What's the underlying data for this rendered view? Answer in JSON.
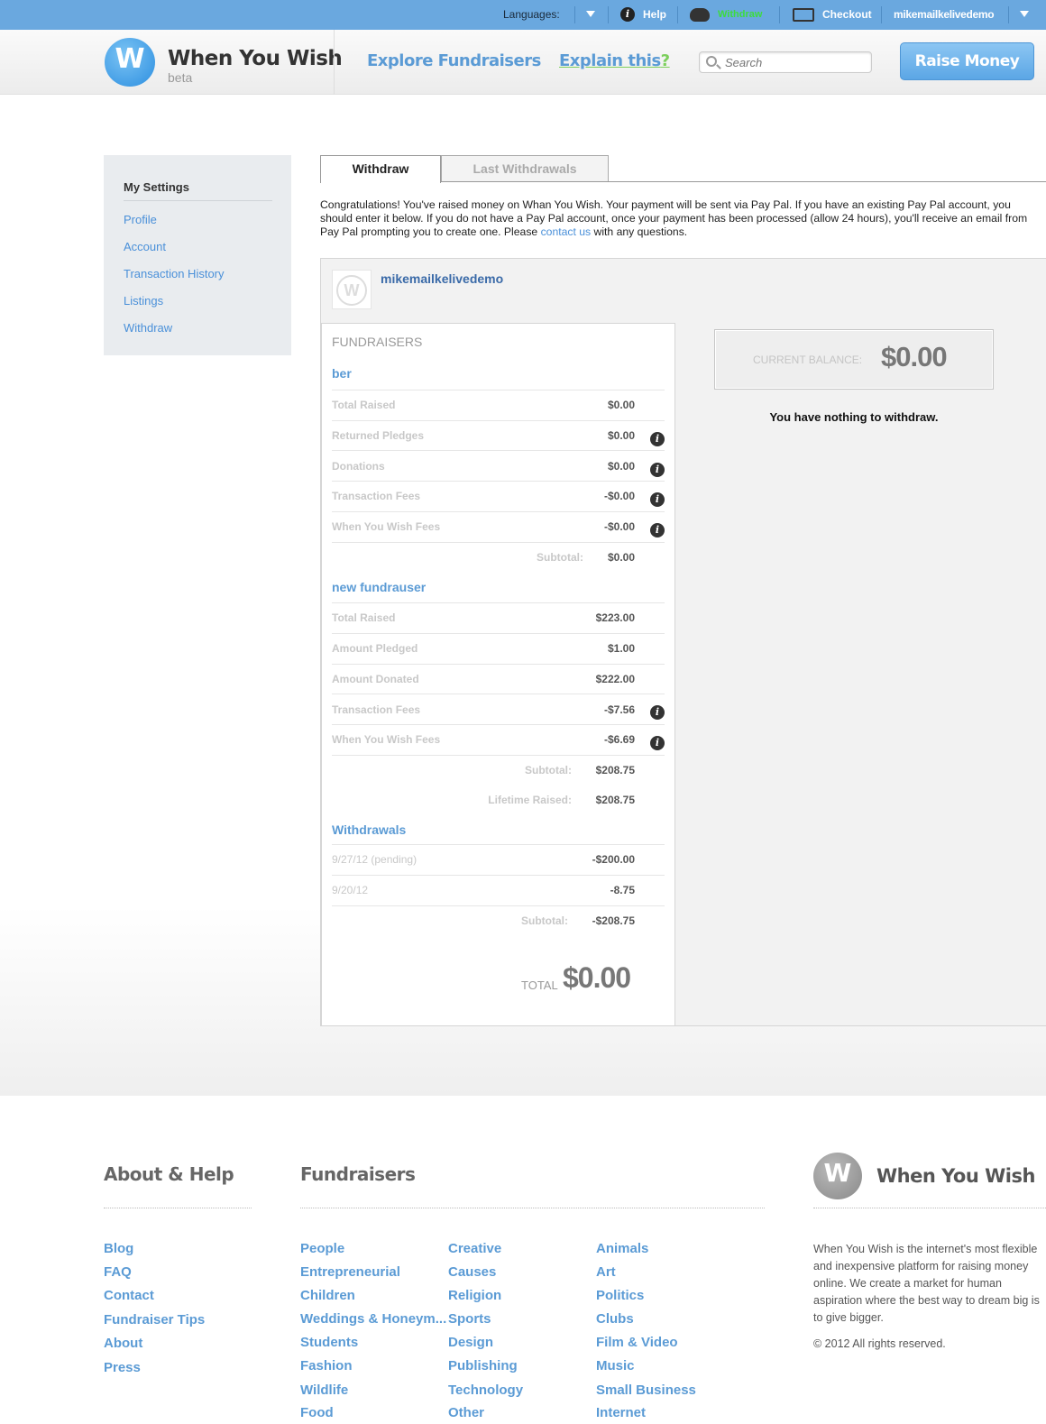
{
  "topbar": {
    "languages_label": "Languages:",
    "help_label": "Help",
    "wishes_label": "Withdraw",
    "checkout_label": "Checkout",
    "username": "mikemailkelivedemo"
  },
  "header": {
    "logo_text": "When You Wish",
    "logo_letter": "W",
    "beta": "beta",
    "explore": "Explore Fundraisers",
    "explain": "Explain this",
    "explain_mark": "?",
    "search_placeholder": "Search",
    "raise_button": "Raise Money"
  },
  "sidebar": {
    "title": "My Settings",
    "items": [
      "Profile",
      "Account",
      "Transaction History",
      "Listings",
      "Withdraw"
    ]
  },
  "tabs": {
    "withdraw": "Withdraw",
    "last_withdrawals": "Last Withdrawals"
  },
  "intro": {
    "text_before": "Congratulations! You've raised money on Whan You Wish. Your payment will be sent via Pay Pal. If you have an existing Pay Pal account, you should enter it below. If you do not have a Pay Pal account, once your payment has been processed (allow 24 hours), you'll receive an email from Pay Pal prompting you to create one. Please ",
    "link": "contact us",
    "text_after": " with any questions."
  },
  "account": {
    "username": "mikemailkelivedemo",
    "avatar_letter": "W"
  },
  "fundraisers": {
    "title": "FUNDRAISERS",
    "f1": {
      "name": "ber",
      "rows": [
        {
          "label": "Total Raised",
          "value": "$0.00"
        },
        {
          "label": "Returned Pledges",
          "value": "$0.00"
        },
        {
          "label": "Donations",
          "value": "$0.00"
        },
        {
          "label": "Transaction Fees",
          "value": "-$0.00"
        },
        {
          "label": "When You Wish Fees",
          "value": "-$0.00"
        }
      ],
      "subtotal_label": "Subtotal:",
      "subtotal": "$0.00"
    },
    "f2": {
      "name": "new fundrauser",
      "rows": [
        {
          "label": "Total Raised",
          "value": "$223.00"
        },
        {
          "label": "Amount Pledged",
          "value": "$1.00"
        },
        {
          "label": "Amount Donated",
          "value": "$222.00"
        },
        {
          "label": "Transaction Fees",
          "value": "-$7.56"
        },
        {
          "label": "When You Wish Fees",
          "value": "-$6.69"
        }
      ],
      "subtotal_label": "Subtotal:",
      "subtotal": "$208.75",
      "lifetime_label": "Lifetime Raised:",
      "lifetime": "$208.75"
    },
    "withdrawals": {
      "name": "Withdrawals",
      "rows": [
        {
          "label": "9/27/12 (pending)",
          "value": "-$200.00"
        },
        {
          "label": "9/20/12",
          "value": "-8.75"
        }
      ],
      "subtotal_label": "Subtotal:",
      "subtotal": "-$208.75"
    },
    "total_label": "TOTAL",
    "total": "$0.00",
    "info_glyph": "i"
  },
  "balance": {
    "label": "CURRENT BALANCE:",
    "value": "$0.00",
    "message": "You have nothing to withdraw."
  },
  "footer": {
    "about_heading": "About & Help",
    "fundraisers_heading": "Fundraisers",
    "about_links": [
      "Blog",
      "FAQ",
      "Contact",
      "Fundraiser Tips",
      "About",
      "Press"
    ],
    "col1": [
      "People",
      "Entrepreneurial",
      "Children",
      "Weddings & Honeym...",
      "Students",
      "Fashion",
      "Wildlife",
      "Food"
    ],
    "col2": [
      "Creative",
      "Causes",
      "Religion",
      "Sports",
      "Design",
      "Publishing",
      "Technology",
      "Other"
    ],
    "col3": [
      "Animals",
      "Art",
      "Politics",
      "Clubs",
      "Film & Video",
      "Music",
      "Small Business",
      "Internet"
    ],
    "logo_text": "When You Wish",
    "logo_letter": "W",
    "about_text": "When You Wish is the internet's most flexible and inexpensive platform for raising money online. We create a market for human aspiration where the best way to dream big is to give bigger.",
    "copyright": "© 2012 All rights reserved."
  },
  "colors": {
    "topbar": "#6aa8df",
    "link_blue": "#5b9bd5",
    "wishes_green": "#3ddc3d"
  },
  "icons": [
    "info-icon",
    "piggy-bank-icon",
    "card-icon",
    "chevron-down-icon",
    "search-icon"
  ]
}
